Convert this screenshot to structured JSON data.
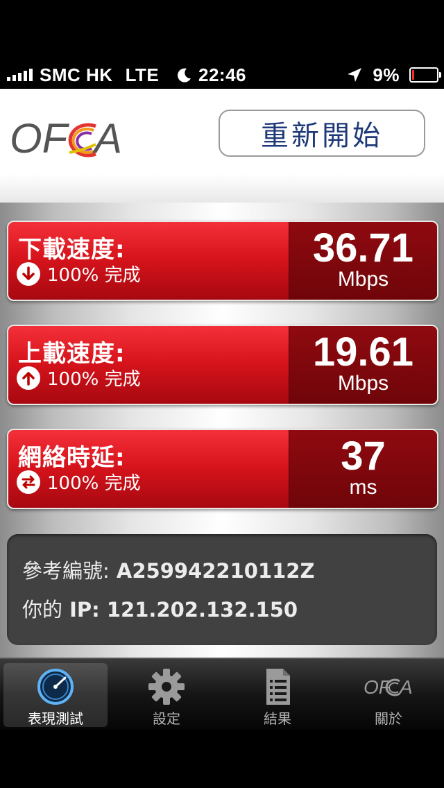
{
  "status_bar": {
    "carrier": "SMC HK",
    "network": "LTE",
    "time": "22:46",
    "battery_percent": "9%",
    "battery_level": 0.09
  },
  "header": {
    "logo_text": "OFCA",
    "restart_label": "重新開始"
  },
  "results": [
    {
      "title": "下載速度:",
      "status": "100% 完成",
      "value": "36.71",
      "unit": "Mbps",
      "icon": "download-arrow-icon"
    },
    {
      "title": "上載速度:",
      "status": "100% 完成",
      "value": "19.61",
      "unit": "Mbps",
      "icon": "upload-arrow-icon"
    },
    {
      "title": "網絡時延:",
      "status": "100% 完成",
      "value": "37",
      "unit": "ms",
      "icon": "latency-arrows-icon"
    }
  ],
  "info": {
    "reference_label": "參考編號:",
    "reference_value": "A259942210112Z",
    "ip_label": "你的",
    "ip_value": "IP: 121.202.132.150"
  },
  "tabs": [
    {
      "label": "表現測試",
      "icon": "speedometer-icon",
      "active": true
    },
    {
      "label": "設定",
      "icon": "gear-icon",
      "active": false
    },
    {
      "label": "結果",
      "icon": "document-list-icon",
      "active": false
    },
    {
      "label": "關於",
      "icon": "ofca-logo-icon",
      "active": false
    }
  ],
  "colors": {
    "card_red": "#d8141c",
    "card_dark": "#7a060c",
    "button_text": "#1f3a78"
  }
}
